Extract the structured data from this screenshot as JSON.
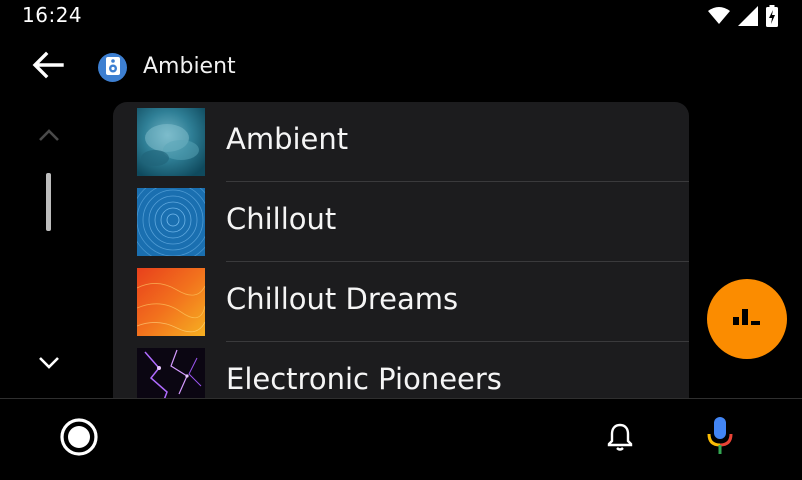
{
  "status_bar": {
    "time": "16:24",
    "icons": [
      "wifi-icon",
      "signal-icon",
      "battery-charging-icon"
    ]
  },
  "header": {
    "back_icon": "arrow-left-icon",
    "app_icon": "speaker-icon",
    "title": "Ambient"
  },
  "scroll": {
    "up_icon": "chevron-up-icon",
    "down_icon": "chevron-down-icon"
  },
  "list": {
    "items": [
      {
        "label": "Ambient",
        "thumb": "smoke-blue"
      },
      {
        "label": "Chillout",
        "thumb": "star-trails-blue"
      },
      {
        "label": "Chillout Dreams",
        "thumb": "orange-texture"
      },
      {
        "label": "Electronic Pioneers",
        "thumb": "purple-lightning"
      }
    ]
  },
  "fab": {
    "icon": "equalizer-bars-icon",
    "color": "#fb8c00"
  },
  "bottom_bar": {
    "home_icon": "home-circle-icon",
    "notifications_icon": "bell-icon",
    "assistant_icon": "microphone-icon"
  },
  "colors": {
    "background": "#000000",
    "card": "#1c1c1e",
    "accent": "#fb8c00",
    "app_icon": "#3d7fd1"
  }
}
